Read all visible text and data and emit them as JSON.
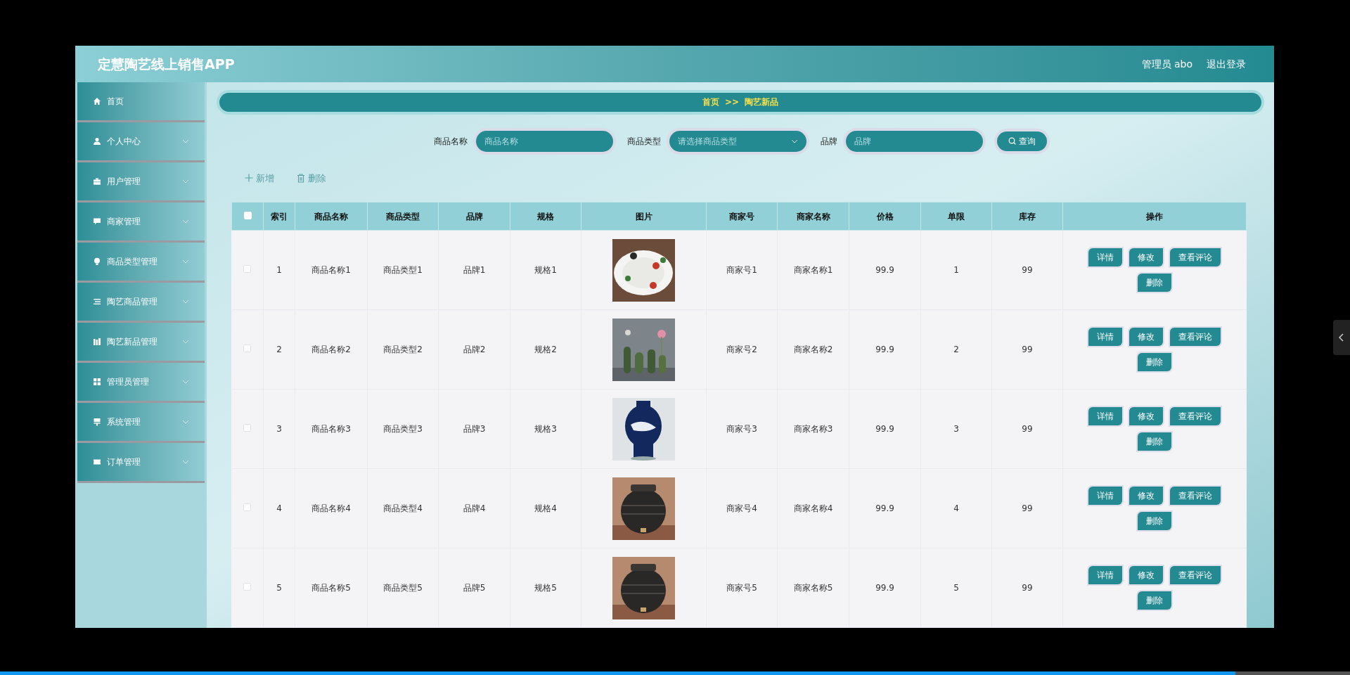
{
  "header": {
    "title": "定慧陶艺线上销售APP",
    "user": "管理员 abo",
    "logout": "退出登录"
  },
  "sidebar": {
    "items": [
      {
        "label": "首页",
        "kind": "link"
      },
      {
        "label": "个人中心",
        "kind": "menu",
        "expanded": false
      },
      {
        "label": "用户管理",
        "kind": "menu",
        "expanded": false
      },
      {
        "label": "商家管理",
        "kind": "menu",
        "expanded": false
      },
      {
        "label": "商品类型管理",
        "kind": "menu",
        "expanded": false
      },
      {
        "label": "陶艺商品管理",
        "kind": "menu",
        "expanded": false
      },
      {
        "label": "陶艺新品管理",
        "kind": "menu",
        "expanded": false
      },
      {
        "label": "管理员管理",
        "kind": "menu",
        "expanded": false
      },
      {
        "label": "系统管理",
        "kind": "menu",
        "expanded": false
      },
      {
        "label": "订单管理",
        "kind": "menu",
        "expanded": false
      }
    ]
  },
  "breadcrumb": [
    "首页",
    ">>",
    "陶艺新品"
  ],
  "search": {
    "fields": [
      {
        "label": "商品名称",
        "placeholder": "商品名称",
        "kind": "text"
      },
      {
        "label": "商品类型",
        "placeholder": "请选择商品类型",
        "kind": "select"
      },
      {
        "label": "品牌",
        "placeholder": "品牌",
        "kind": "text"
      }
    ],
    "button": "查询"
  },
  "actions": [
    "新增",
    "删除"
  ],
  "table": {
    "select_all": {
      "checked": false
    },
    "columns": [
      "索引",
      "商品名称",
      "商品类型",
      "品牌",
      "规格",
      "图片",
      "商家号",
      "商家名称",
      "价格",
      "单限",
      "库存",
      "操作"
    ],
    "rows": [
      {
        "checked": false,
        "cells": [
          "1",
          "商品名称1",
          "商品类型1",
          "品牌1",
          "规格1"
        ],
        "image": {
          "kind": "picture"
        },
        "cells_after": [
          "商家号1",
          "商家名称1",
          "99.9",
          "1",
          "99"
        ],
        "buttons": [
          "详情",
          "修改",
          "查看评论",
          "删除"
        ]
      },
      {
        "checked": false,
        "cells": [
          "2",
          "商品名称2",
          "商品类型2",
          "品牌2",
          "规格2"
        ],
        "image": {
          "kind": "picture"
        },
        "cells_after": [
          "商家号2",
          "商家名称2",
          "99.9",
          "2",
          "99"
        ],
        "buttons": [
          "详情",
          "修改",
          "查看评论",
          "删除"
        ]
      },
      {
        "checked": false,
        "cells": [
          "3",
          "商品名称3",
          "商品类型3",
          "品牌3",
          "规格3"
        ],
        "image": {
          "kind": "picture"
        },
        "cells_after": [
          "商家号3",
          "商家名称3",
          "99.9",
          "3",
          "99"
        ],
        "buttons": [
          "详情",
          "修改",
          "查看评论",
          "删除"
        ]
      },
      {
        "checked": false,
        "cells": [
          "4",
          "商品名称4",
          "商品类型4",
          "品牌4",
          "规格4"
        ],
        "image": {
          "kind": "picture"
        },
        "cells_after": [
          "商家号4",
          "商家名称4",
          "99.9",
          "4",
          "99"
        ],
        "buttons": [
          "详情",
          "修改",
          "查看评论",
          "删除"
        ]
      },
      {
        "checked": false,
        "cells": [
          "5",
          "商品名称5",
          "商品类型5",
          "品牌5",
          "规格5"
        ],
        "image": {
          "kind": "picture"
        },
        "cells_after": [
          "商家号5",
          "商家名称5",
          "99.9",
          "5",
          "99"
        ],
        "buttons": [
          "详情",
          "修改",
          "查看评论",
          "删除"
        ]
      }
    ]
  },
  "player": {
    "level": 0.915
  }
}
